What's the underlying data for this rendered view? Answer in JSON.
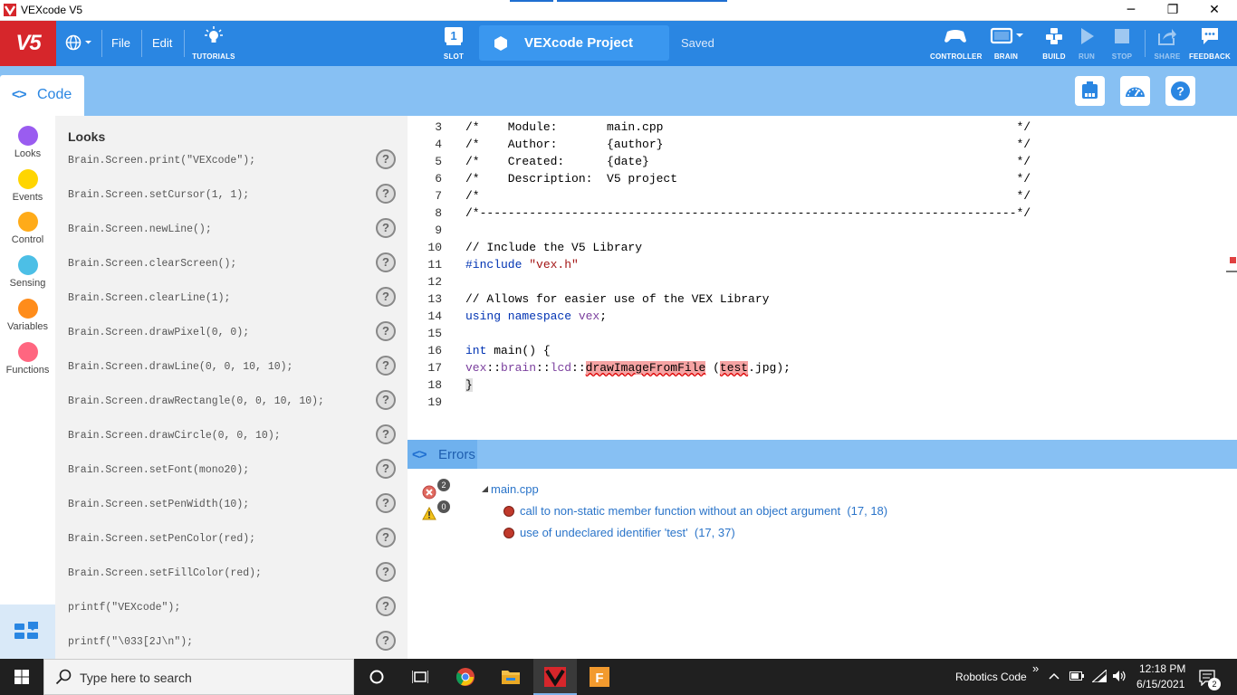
{
  "window": {
    "title": "VEXcode V5",
    "controls": {
      "minimize": "─",
      "restore": "❐",
      "close": "✕"
    }
  },
  "toolbar": {
    "logo": "V5",
    "file": "File",
    "edit": "Edit",
    "tutorials": "TUTORIALS",
    "slot_number": "1",
    "slot": "SLOT",
    "project_name": "VEXcode Project",
    "saved": "Saved",
    "controller": "CONTROLLER",
    "brain": "BRAIN",
    "build": "BUILD",
    "run": "RUN",
    "stop": "STOP",
    "share": "SHARE",
    "feedback": "FEEDBACK",
    "colors": {
      "bar": "#2a86e2",
      "logo": "#d6262b"
    }
  },
  "subbar": {
    "code_tab": "Code",
    "code_chevron": "<>"
  },
  "categories": [
    {
      "label": "Looks",
      "color": "#9a5cf0"
    },
    {
      "label": "Events",
      "color": "#ffd500"
    },
    {
      "label": "Control",
      "color": "#ffab19"
    },
    {
      "label": "Sensing",
      "color": "#4cbfe6"
    },
    {
      "label": "Variables",
      "color": "#ff8c1a"
    },
    {
      "label": "Functions",
      "color": "#ff6680"
    }
  ],
  "palette": {
    "heading": "Looks",
    "help": "?",
    "snippets": [
      "Brain.Screen.print(\"VEXcode\");",
      "Brain.Screen.setCursor(1, 1);",
      "Brain.Screen.newLine();",
      "Brain.Screen.clearScreen();",
      "Brain.Screen.clearLine(1);",
      "Brain.Screen.drawPixel(0, 0);",
      "Brain.Screen.drawLine(0, 0, 10, 10);",
      "Brain.Screen.drawRectangle(0, 0, 10, 10);",
      "Brain.Screen.drawCircle(0, 0, 10);",
      "Brain.Screen.setFont(mono20);",
      "Brain.Screen.setPenWidth(10);",
      "Brain.Screen.setPenColor(red);",
      "Brain.Screen.setFillColor(red);",
      "printf(\"VEXcode\");",
      "printf(\"\\033[2J\\n\");"
    ]
  },
  "editor": {
    "line_numbers": [
      "3",
      "4",
      "5",
      "6",
      "7",
      "8",
      "9",
      "10",
      "11",
      "12",
      "13",
      "14",
      "15",
      "16",
      "17",
      "18",
      "19"
    ],
    "l3": "/*    Module:       main.cpp                                                  */",
    "l4": "/*    Author:       {author}                                                  */",
    "l5": "/*    Created:      {date}                                                    */",
    "l6": "/*    Description:  V5 project                                                */",
    "l7": "/*                                                                            */",
    "l8": "/*----------------------------------------------------------------------------*/",
    "l10": "// Include the V5 Library",
    "l11_kw": "#include",
    "l11_str": " \"vex.h\"",
    "l13": "// Allows for easier use of the VEX Library",
    "l14_kw": "using namespace",
    "l14_ns": " vex",
    "l14_end": ";",
    "l16_kw": "int",
    "l16_rest": " main() {",
    "l17_a": "vex",
    "l17_b": "::",
    "l17_c": "brain",
    "l17_d": "::",
    "l17_e": "lcd",
    "l17_f": "::",
    "l17_g": "drawImageFromFile",
    "l17_h": " (",
    "l17_i": "test",
    "l17_j": ".jpg);",
    "l18": "}"
  },
  "errors": {
    "tab": "Errors",
    "chevron": "<>",
    "error_count": "2",
    "warning_count": "0",
    "file": "main.cpp",
    "items": [
      {
        "message": "call to non-static member function without an object argument",
        "loc": "(17, 18)"
      },
      {
        "message": "use of undeclared identifier 'test'",
        "loc": "(17, 37)"
      }
    ]
  },
  "taskbar": {
    "search_placeholder": "Type here to search",
    "robotics": "Robotics Code",
    "expand": "»",
    "time": "12:18 PM",
    "date": "6/15/2021",
    "notifications": "2"
  }
}
